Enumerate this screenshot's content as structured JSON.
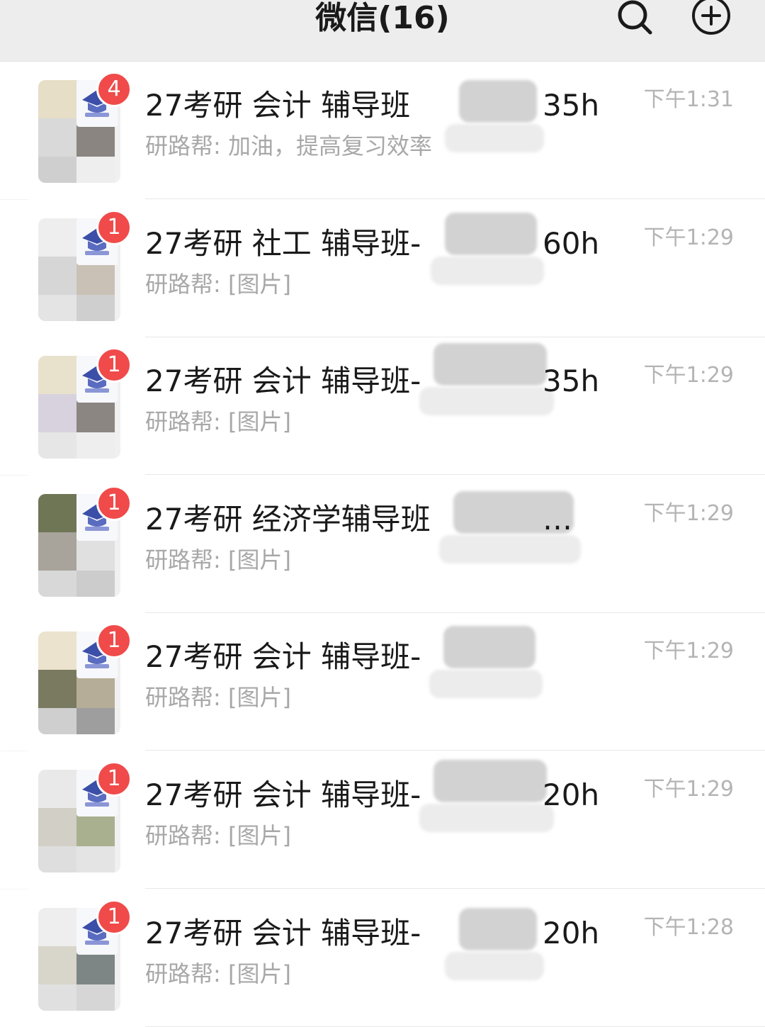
{
  "header": {
    "title": "微信(16)",
    "search_icon": "search-icon",
    "add_icon": "plus-circle-icon"
  },
  "colors": {
    "badge": "#f04a4a",
    "header_bg": "#ededed",
    "title_text": "#1a1a1a",
    "preview_text": "#a8a8a8",
    "time_text": "#b4b4b4"
  },
  "chats": [
    {
      "badge": "4",
      "title_prefix": "27考研 会计 辅导班",
      "title_suffix": "35h",
      "preview": "研路帮: 加油，提高复习效率",
      "time": "下午1:31"
    },
    {
      "badge": "1",
      "title_prefix": "27考研 社工 辅导班-",
      "title_suffix": "60h",
      "preview": "研路帮: [图片]",
      "time": "下午1:29"
    },
    {
      "badge": "1",
      "title_prefix": "27考研 会计 辅导班-",
      "title_suffix": "35h",
      "preview": "研路帮: [图片]",
      "time": "下午1:29"
    },
    {
      "badge": "1",
      "title_prefix": "27考研 经济学辅导班",
      "title_suffix": "…",
      "preview": "研路帮: [图片]",
      "time": "下午1:29"
    },
    {
      "badge": "1",
      "title_prefix": "27考研 会计 辅导班-",
      "title_suffix": "",
      "preview": "研路帮: [图片]",
      "time": "下午1:29"
    },
    {
      "badge": "1",
      "title_prefix": "27考研 会计 辅导班-",
      "title_suffix": "20h",
      "preview": "研路帮: [图片]",
      "time": "下午1:29"
    },
    {
      "badge": "1",
      "title_prefix": "27考研 会计 辅导班-",
      "title_suffix": "20h",
      "preview": "研路帮: [图片]",
      "time": "下午1:28"
    }
  ]
}
